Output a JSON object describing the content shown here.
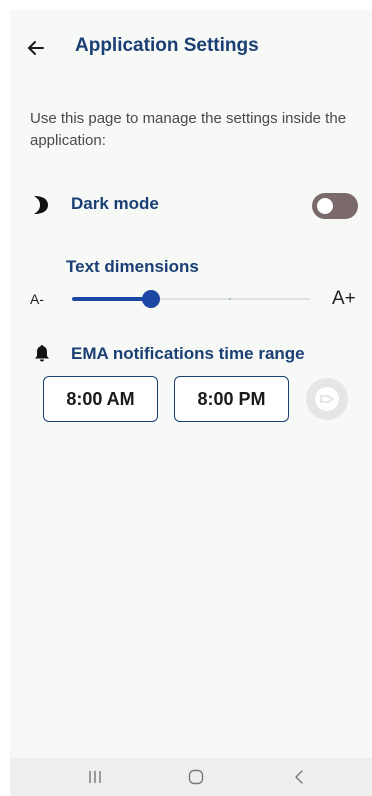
{
  "header": {
    "title": "Application Settings",
    "back_icon": "arrow-left-icon"
  },
  "intro_text": "Use this page to manage the settings inside the application:",
  "dark_mode": {
    "label": "Dark mode",
    "icon": "crescent-moon-icon",
    "enabled": false
  },
  "text_dimensions": {
    "label": "Text dimensions",
    "min_label": "A-",
    "max_label": "A+",
    "level": 0.33
  },
  "notifications": {
    "label": "EMA notifications time range",
    "icon": "bell-icon",
    "start_time": "8:00 AM",
    "end_time": "8:00 PM",
    "confirm_icon": "send-icon",
    "confirm_enabled": false
  },
  "colors": {
    "primary": "#1b3f75",
    "accent": "#1c48a3",
    "background": "#f6f9f6",
    "toggle_off": "#7a6a6c"
  },
  "system_nav": {
    "recents_icon": "recents-icon",
    "home_icon": "home-icon",
    "back_icon": "nav-back-icon"
  }
}
